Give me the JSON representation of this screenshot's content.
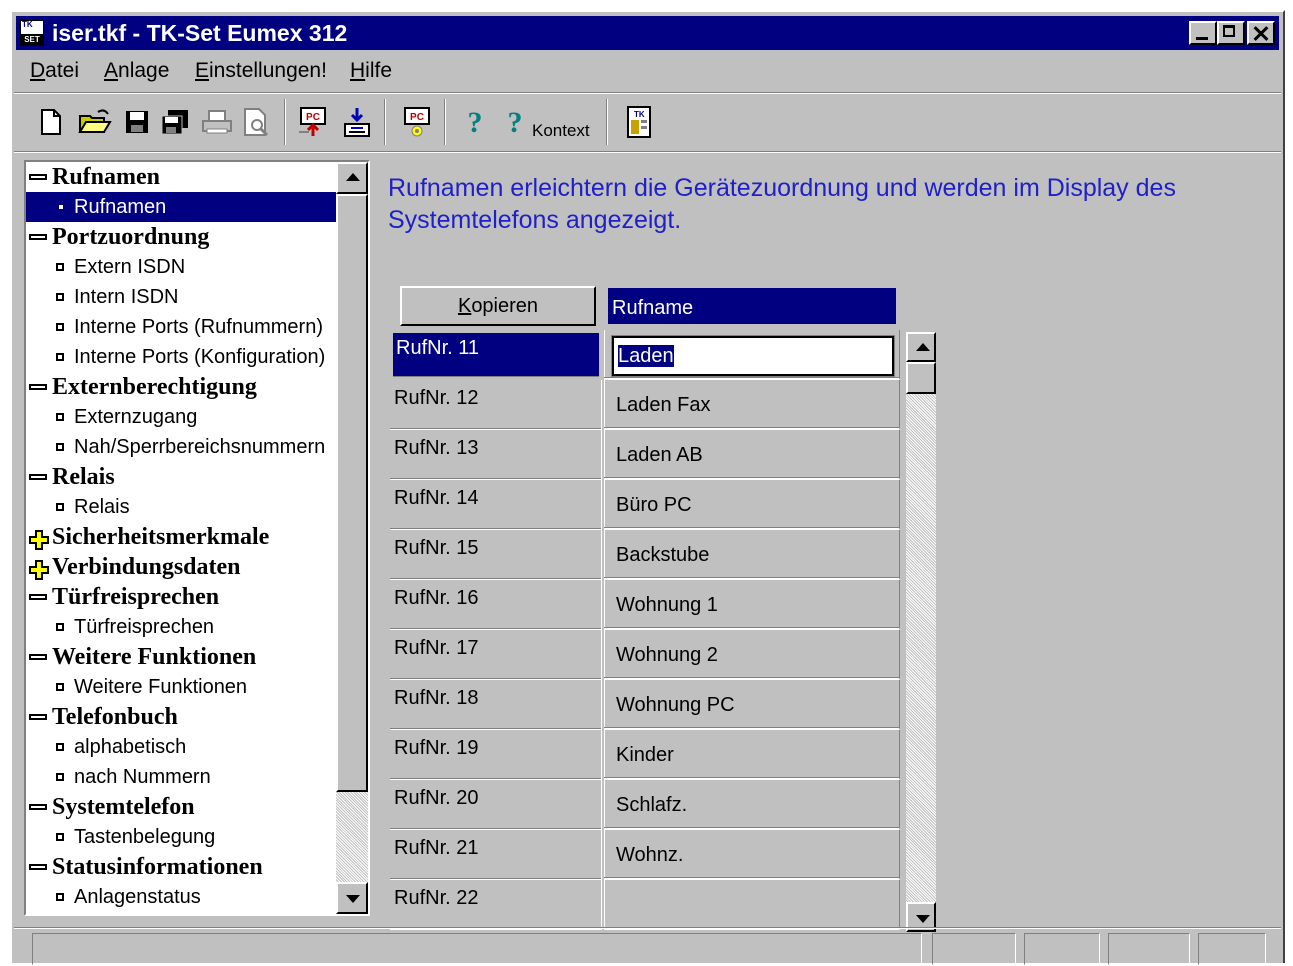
{
  "window": {
    "title": "iser.tkf - TK-Set Eumex 312",
    "icon_text_top": "TK",
    "icon_text_bottom": "SET"
  },
  "menu": [
    {
      "pre": "",
      "u": "D",
      "post": "atei"
    },
    {
      "pre": "",
      "u": "A",
      "post": "nlage"
    },
    {
      "pre": "",
      "u": "E",
      "post": "instellungen!"
    },
    {
      "pre": "",
      "u": "H",
      "post": "ilfe"
    }
  ],
  "toolbar": {
    "items": [
      "new-file-icon",
      "open-folder-icon",
      "save-icon",
      "save-all-icon",
      "print-icon",
      "print-preview-icon",
      "pc-to-device-icon",
      "device-to-pc-icon",
      "pc-settings-icon",
      "help-icon",
      "context-help-icon",
      "about-icon"
    ],
    "context_label": "Kontext"
  },
  "tree": {
    "items": [
      {
        "type": "head",
        "state": "minus",
        "label": "Rufnamen"
      },
      {
        "type": "child",
        "label": "Rufnamen",
        "selected": true
      },
      {
        "type": "head",
        "state": "minus",
        "label": "Portzuordnung"
      },
      {
        "type": "child",
        "label": "Extern ISDN"
      },
      {
        "type": "child",
        "label": "Intern ISDN"
      },
      {
        "type": "child",
        "label": "Interne Ports (Rufnummern)"
      },
      {
        "type": "child",
        "label": "Interne Ports (Konfiguration)"
      },
      {
        "type": "head",
        "state": "minus",
        "label": "Externberechtigung"
      },
      {
        "type": "child",
        "label": "Externzugang"
      },
      {
        "type": "child",
        "label": "Nah/Sperrbereichsnummern"
      },
      {
        "type": "head",
        "state": "minus",
        "label": "Relais"
      },
      {
        "type": "child",
        "label": "Relais"
      },
      {
        "type": "head",
        "state": "plus",
        "label": "Sicherheitsmerkmale"
      },
      {
        "type": "head",
        "state": "plus",
        "label": "Verbindungsdaten"
      },
      {
        "type": "head",
        "state": "minus",
        "label": "Türfreisprechen"
      },
      {
        "type": "child",
        "label": "Türfreisprechen"
      },
      {
        "type": "head",
        "state": "minus",
        "label": "Weitere Funktionen"
      },
      {
        "type": "child",
        "label": "Weitere Funktionen"
      },
      {
        "type": "head",
        "state": "minus",
        "label": "Telefonbuch"
      },
      {
        "type": "child",
        "label": "alphabetisch"
      },
      {
        "type": "child",
        "label": "nach Nummern"
      },
      {
        "type": "head",
        "state": "minus",
        "label": "Systemtelefon"
      },
      {
        "type": "child",
        "label": "Tastenbelegung"
      },
      {
        "type": "head",
        "state": "minus",
        "label": "Statusinformationen"
      },
      {
        "type": "child",
        "label": "Anlagenstatus"
      }
    ]
  },
  "description": "Rufnamen erleichtern die Gerätezuordnung und werden im Display des Systemtelefons angezeigt.",
  "grid": {
    "copy_button": {
      "u": "K",
      "post": "opieren"
    },
    "column_header": "Rufname",
    "rows": [
      {
        "nr": "RufNr. 11",
        "name": "Laden",
        "active": true
      },
      {
        "nr": "RufNr. 12",
        "name": "Laden Fax"
      },
      {
        "nr": "RufNr. 13",
        "name": "Laden AB"
      },
      {
        "nr": "RufNr. 14",
        "name": "Büro PC"
      },
      {
        "nr": "RufNr. 15",
        "name": "Backstube"
      },
      {
        "nr": "RufNr. 16",
        "name": "Wohnung 1"
      },
      {
        "nr": "RufNr. 17",
        "name": "Wohnung 2"
      },
      {
        "nr": "RufNr. 18",
        "name": "Wohnung PC"
      },
      {
        "nr": "RufNr. 19",
        "name": "Kinder"
      },
      {
        "nr": "RufNr. 20",
        "name": "Schlafz."
      },
      {
        "nr": "RufNr. 21",
        "name": "Wohnz."
      },
      {
        "nr": "RufNr. 22",
        "name": ""
      }
    ]
  },
  "status": {
    "panes": [
      "",
      "",
      "",
      "",
      ""
    ]
  },
  "colors": {
    "title_bar": "#000080",
    "selection": "#000080",
    "description_text": "#2020c8",
    "face": "#c0c0c0"
  }
}
